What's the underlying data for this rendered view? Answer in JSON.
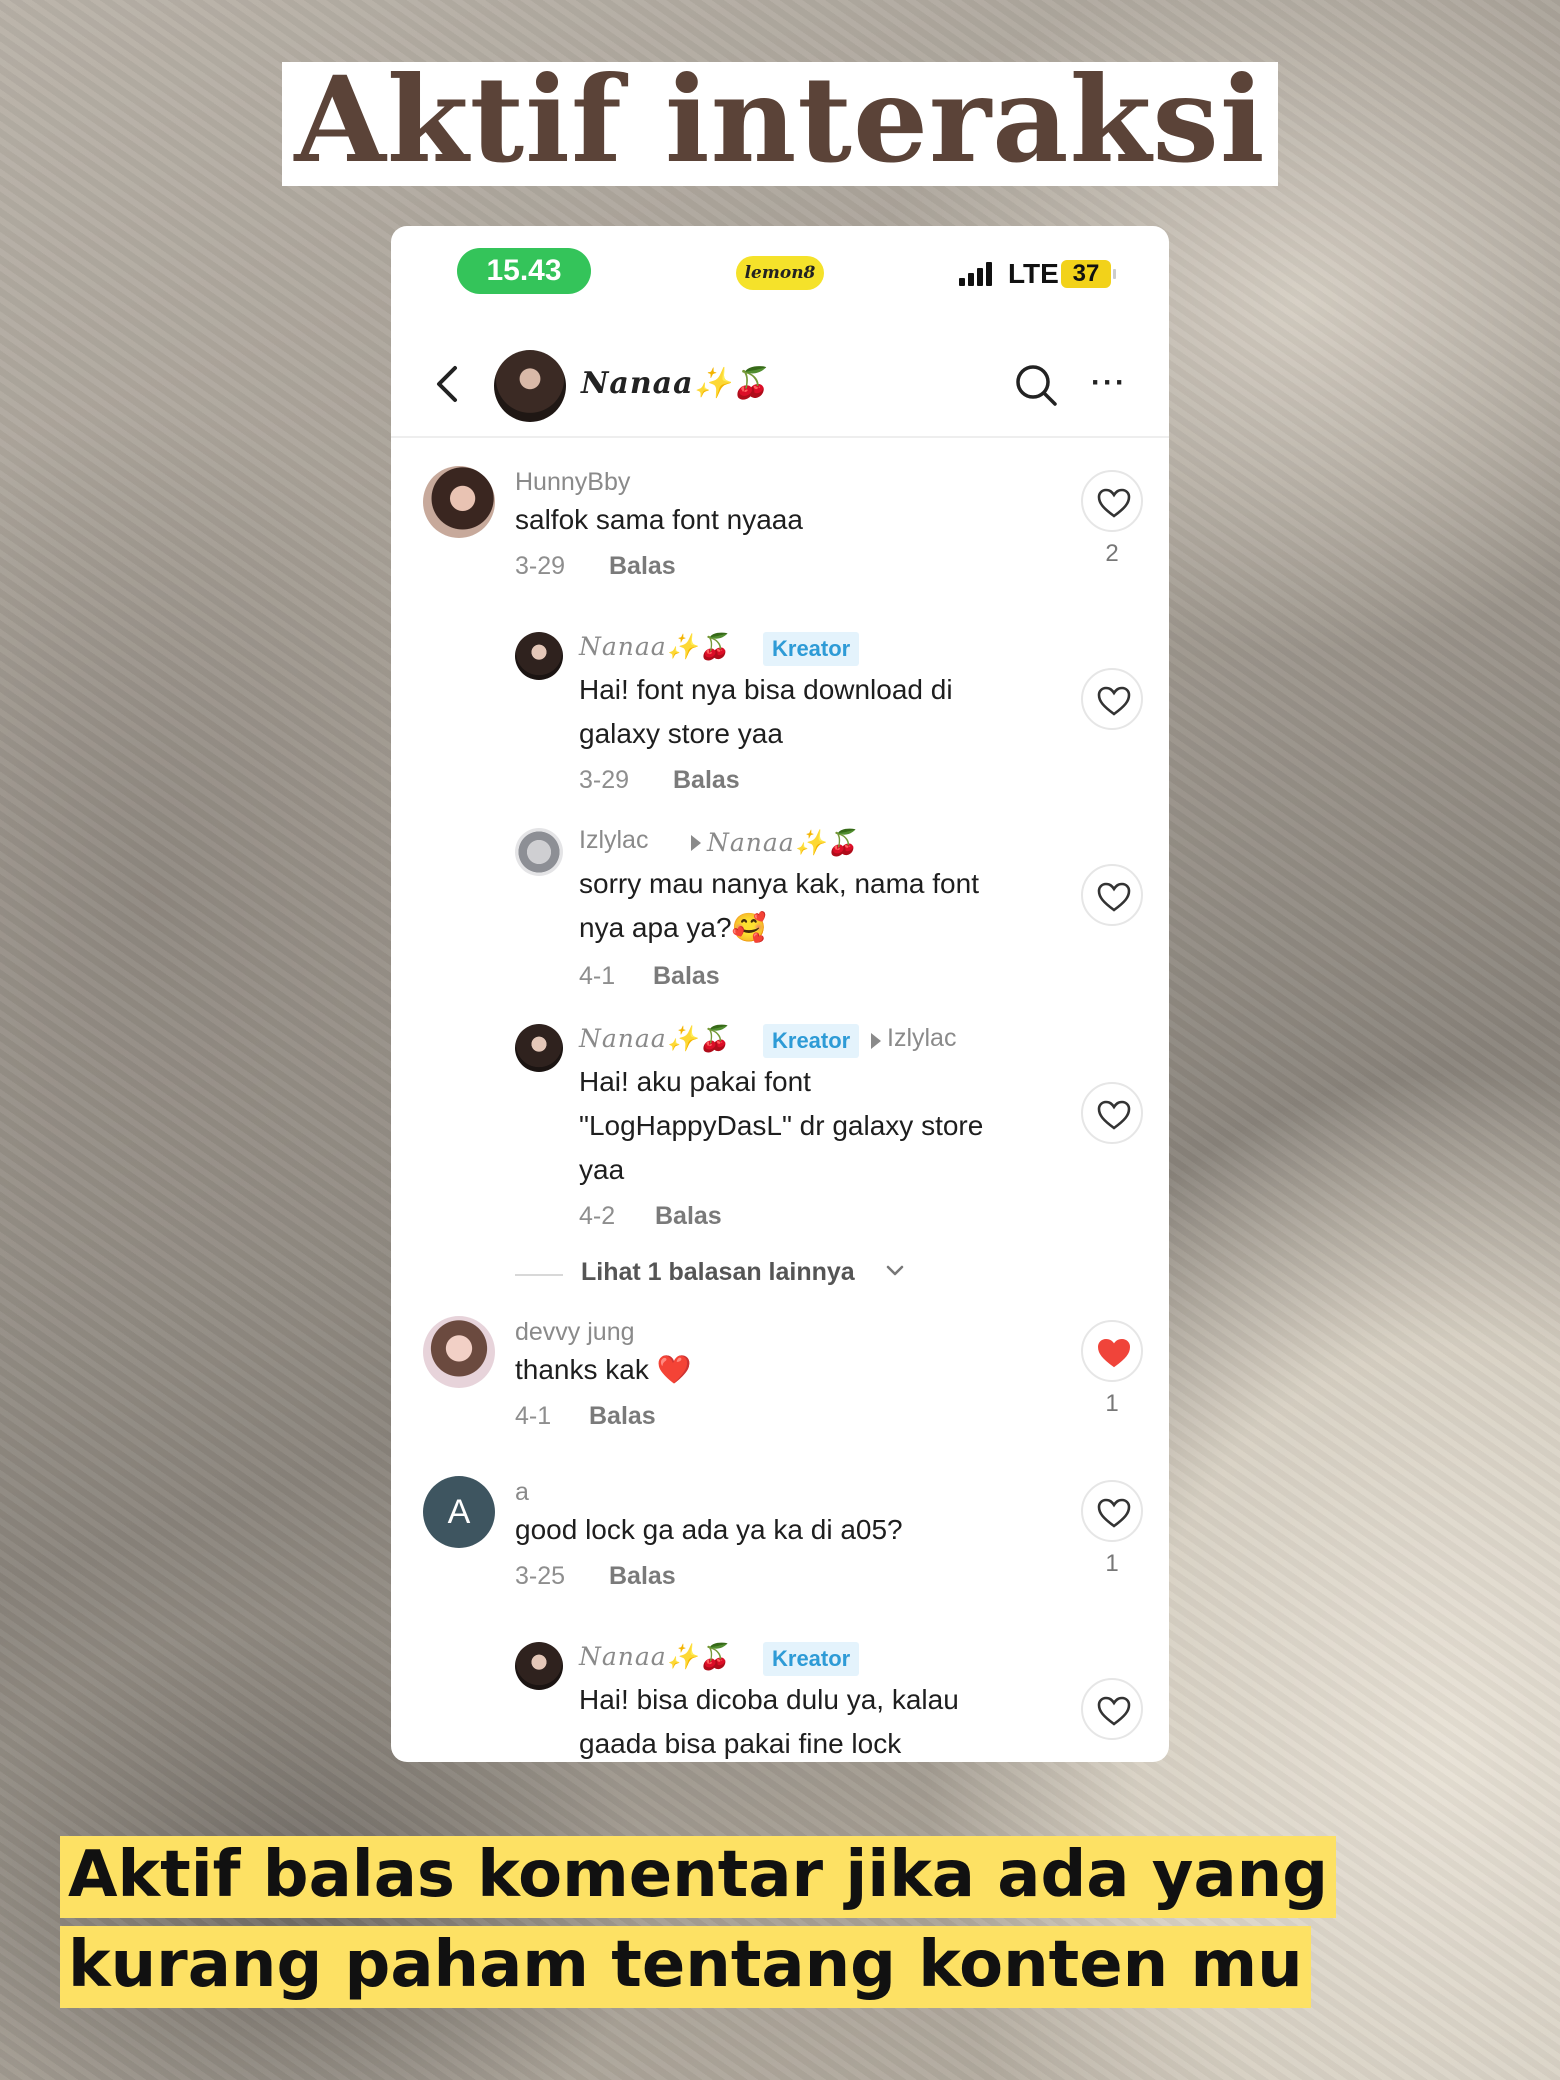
{
  "title": "Aktif interaksi",
  "caption": "Aktif balas komentar jika ada yang kurang paham tentang konten mu",
  "status_bar": {
    "time": "15.43",
    "app_badge": "lemon8",
    "network": "LTE",
    "battery": "37"
  },
  "header": {
    "back_icon": "chevron-left-icon",
    "profile_name": "Nanaa✨🍒",
    "search_icon": "search-icon",
    "more_icon": "more-horizontal-icon"
  },
  "comments": [
    {
      "user": "HunnyBby",
      "text": "salfok sama font nyaaa",
      "date": "3-29",
      "reply_label": "Balas",
      "likes": "2",
      "liked": false,
      "replies": [
        {
          "user": "Nanaa✨🍒",
          "badge": "Kreator",
          "text_lines": [
            "Hai! font nya bisa download di",
            "galaxy store yaa"
          ],
          "date": "3-29",
          "reply_label": "Balas"
        },
        {
          "user": "Izlylac",
          "reply_to": "Nanaa✨🍒",
          "text_lines": [
            " sorry mau nanya kak, nama font",
            "nya apa ya?🥰"
          ],
          "date": "4-1",
          "reply_label": "Balas"
        },
        {
          "user": "Nanaa✨🍒",
          "badge": "Kreator",
          "reply_to": "Izlylac",
          "text_lines": [
            " Hai! aku pakai font",
            "\"LogHappyDasL\" dr galaxy store",
            "yaa"
          ],
          "date": "4-2",
          "reply_label": "Balas"
        }
      ],
      "more_replies": "Lihat 1 balasan lainnya"
    },
    {
      "user": "devvy jung",
      "text": "thanks kak ❤️",
      "date": "4-1",
      "reply_label": "Balas",
      "likes": "1",
      "liked": true
    },
    {
      "user": "a",
      "avatar_letter": "A",
      "text": "good lock ga ada ya ka di a05?",
      "date": "3-25",
      "reply_label": "Balas",
      "likes": "1",
      "liked": false,
      "replies": [
        {
          "user": "Nanaa✨🍒",
          "badge": "Kreator",
          "text_lines": [
            "Hai! bisa dicoba dulu ya, kalau",
            "gaada bisa pakai fine lock"
          ]
        }
      ]
    }
  ],
  "colors": {
    "title_text": "#5b4338",
    "caption_highlight": "#fde164",
    "time_pill": "#34c45a",
    "kreator_badge_text": "#2e9bd6",
    "liked_heart": "#f0443a"
  }
}
